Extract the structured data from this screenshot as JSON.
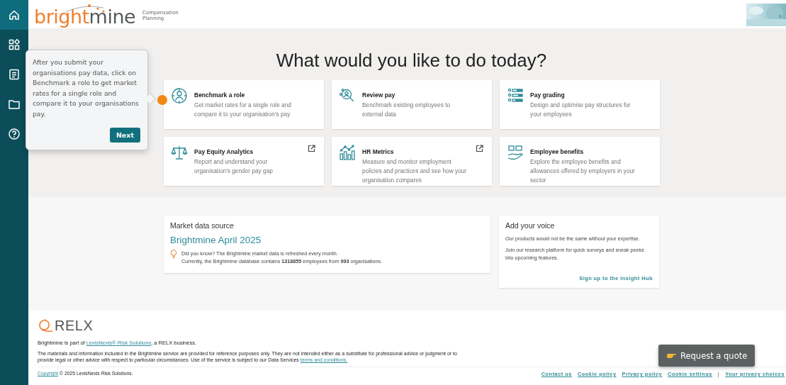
{
  "sidebar": {
    "items": [
      {
        "kind": "home",
        "selected": true
      },
      {
        "kind": "apps",
        "selected": false
      },
      {
        "kind": "document",
        "selected": false
      },
      {
        "kind": "folder",
        "selected": false
      },
      {
        "kind": "help",
        "selected": false
      }
    ]
  },
  "header": {
    "logo": {
      "accent": "bright",
      "rest": "mine"
    },
    "product": "Compensation Planning"
  },
  "heading": "What would you like to do today?",
  "cards": [
    {
      "kind": "benchmark",
      "title": "Benchmark a role",
      "description": "Get market rates for a single role and compare it to your organisation's pay",
      "external": false
    },
    {
      "kind": "review",
      "title": "Review pay",
      "description": "Benchmark existing employees to external data",
      "external": false
    },
    {
      "kind": "grading",
      "title": "Pay grading",
      "description": "Design and optimise pay structures for your employees",
      "external": false
    },
    {
      "kind": "equity",
      "title": "Pay Equity Analytics",
      "description": "Report and understand your organisation's gender pay gap",
      "external": true
    },
    {
      "kind": "metrics",
      "title": "HR Metrics",
      "description": "Measure and monitor employment policies and practices and see how your organisation compares",
      "external": true
    },
    {
      "kind": "benefits",
      "title": "Employee benefits",
      "description": "Explore the employee benefits and allowances offered by employers in your sector",
      "external": false
    }
  ],
  "tour": {
    "text": "After you submit your organisations pay data, click on Benchmark a role to get market rates for a single role and compare it to your organisations pay.",
    "button": "Next"
  },
  "market": {
    "title": "Market data source",
    "source": "Brightmine April 2025",
    "lines": [
      "Did you know? The Brightmine market data is refreshed every month.",
      "Currently, the Brightmine database contains **1318855** employees from **993** organisations."
    ]
  },
  "voice": {
    "title": "Add your voice",
    "paragraphs": [
      "Our products would not be the same without your expertise.",
      "Join our research platform for quick surveys and sneak peeks into upcoming features."
    ],
    "link": "Sign up to the Insight Hub"
  },
  "footer": {
    "logo": "RELX",
    "part_of": {
      "before": "Brightmine is part of ",
      "link": "LexisNexis® Risk Solutions",
      "after": ", a RELX business."
    },
    "legal": {
      "before": "The materials and information included in the Brightmine service are provided for reference purposes only. They are not intended either as a substitute for professional advice or judgment or to provide legal or other advice with respect to particular circumstances. Use of the service is subject to our Data Services ",
      "link": "terms and conditions."
    },
    "copyright": {
      "link": "Copyright",
      "after": " © 2025 LexisNexis Risk Solutions."
    },
    "links": [
      {
        "kind": "link",
        "label": "Contact us"
      },
      {
        "kind": "link",
        "label": "Cookie policy"
      },
      {
        "kind": "link",
        "label": "Privacy policy"
      },
      {
        "kind": "link",
        "label": "Cookie settings"
      },
      {
        "kind": "separator",
        "label": "|"
      },
      {
        "kind": "link",
        "label": "Your privacy choices"
      }
    ]
  },
  "quote_button": {
    "label": "Request a quote"
  }
}
